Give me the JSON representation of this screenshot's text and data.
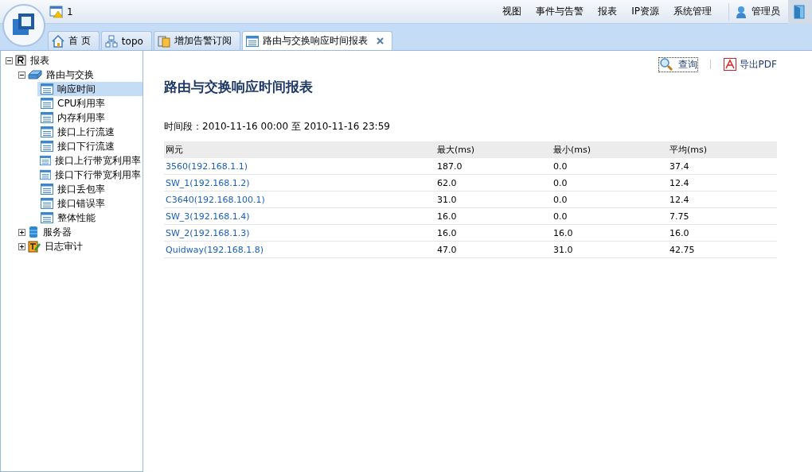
{
  "alert_badge": {
    "count": "1"
  },
  "menu": [
    "视图",
    "事件与告警",
    "报表",
    "IP资源",
    "系统管理"
  ],
  "user": {
    "name": "管理员"
  },
  "tabs": [
    {
      "label": "首 页",
      "kind": "home",
      "selected": false,
      "closable": false
    },
    {
      "label": "topo",
      "kind": "topo",
      "selected": false,
      "closable": false
    },
    {
      "label": "增加告警订阅",
      "kind": "alert",
      "selected": false,
      "closable": false
    },
    {
      "label": "路由与交换响应时间报表",
      "kind": "list",
      "selected": true,
      "closable": true
    }
  ],
  "tree": [
    {
      "label": "报表",
      "kind": "report",
      "expanded": true,
      "selected": false,
      "children": [
        {
          "label": "路由与交换",
          "kind": "switch",
          "expanded": true,
          "selected": false,
          "children": [
            {
              "label": "响应时间",
              "kind": "doc",
              "selected": true
            },
            {
              "label": "CPU利用率",
              "kind": "doc",
              "selected": false
            },
            {
              "label": "内存利用率",
              "kind": "doc",
              "selected": false
            },
            {
              "label": "接口上行流速",
              "kind": "doc",
              "selected": false
            },
            {
              "label": "接口下行流速",
              "kind": "doc",
              "selected": false
            },
            {
              "label": "接口上行带宽利用率",
              "kind": "doc",
              "selected": false
            },
            {
              "label": "接口下行带宽利用率",
              "kind": "doc",
              "selected": false
            },
            {
              "label": "接口丢包率",
              "kind": "doc",
              "selected": false
            },
            {
              "label": "接口错误率",
              "kind": "doc",
              "selected": false
            },
            {
              "label": "整体性能",
              "kind": "doc",
              "selected": false
            }
          ]
        },
        {
          "label": "服务器",
          "kind": "server",
          "expanded": false,
          "selected": false
        },
        {
          "label": "日志审计",
          "kind": "audit",
          "expanded": false,
          "selected": false
        }
      ]
    }
  ],
  "actions": [
    {
      "label": "查询",
      "kind": "search"
    },
    {
      "label": "导出PDF",
      "kind": "pdf"
    }
  ],
  "report": {
    "title": "路由与交换响应时间报表",
    "period": "时间段：2010-11-16 00:00 至 2010-11-16 23:59",
    "columns": [
      "网元",
      "最大(ms)",
      "最小(ms)",
      "平均(ms)"
    ],
    "rows": [
      [
        "3560(192.168.1.1)",
        "187.0",
        "0.0",
        "37.4"
      ],
      [
        "SW_1(192.168.1.2)",
        "62.0",
        "0.0",
        "12.4"
      ],
      [
        "C3640(192.168.100.1)",
        "31.0",
        "0.0",
        "12.4"
      ],
      [
        "SW_3(192.168.1.4)",
        "16.0",
        "0.0",
        "7.75"
      ],
      [
        "SW_2(192.168.1.3)",
        "16.0",
        "16.0",
        "16.0"
      ],
      [
        "Quidway(192.168.1.8)",
        "47.0",
        "31.0",
        "42.75"
      ]
    ]
  }
}
